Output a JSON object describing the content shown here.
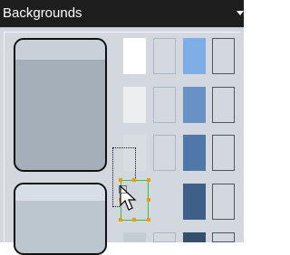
{
  "panel": {
    "title": "Backgrounds",
    "collapse_icon": "chevron-down-icon"
  },
  "swatches": {
    "large": [
      {
        "name": "rounded-rect-large",
        "fill": "#a4afb9",
        "top_band": "#c8d1da"
      },
      {
        "name": "rounded-rect-large-2",
        "fill": "#bcc6cf",
        "top_band": "#d6dee7"
      }
    ],
    "grid": [
      [
        "#ffffff",
        "#d3d9df",
        "#7faee6",
        "#d2d8de"
      ],
      [
        "#eceef0",
        "#cdd4da",
        "#6892c5",
        "#d2d8de"
      ],
      [
        "#d8dde2",
        "#cdd4da",
        "#4f77a8",
        "#d2d8de"
      ],
      [
        "#d1d7dd",
        "#cfd6dc",
        "#3d5f88",
        "#d2d8de"
      ],
      [
        "#c3cbd2",
        "#cbd2d9",
        "#34506f",
        "#d2d8de"
      ]
    ]
  },
  "interaction": {
    "cursor_icon": "arrow-cursor-icon",
    "selection_handle_color": "#f39c00",
    "selection_outline_color": "#3ec03e"
  }
}
